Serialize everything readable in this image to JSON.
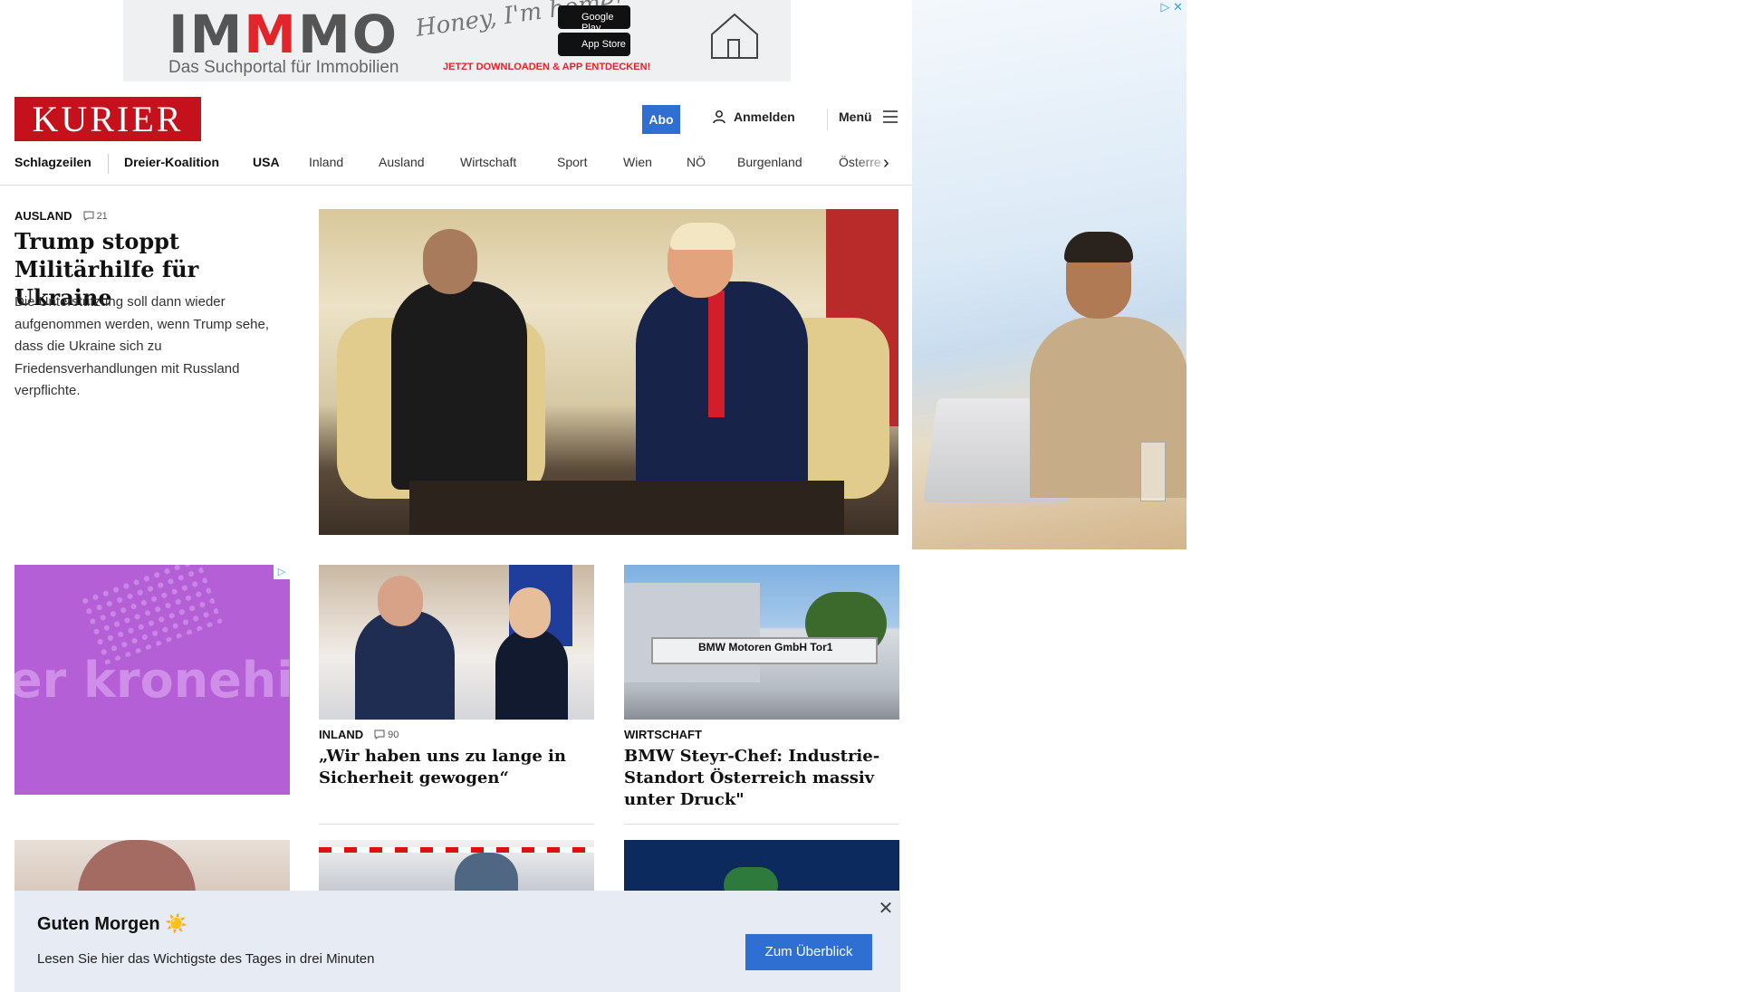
{
  "top_ad": {
    "brand_pre": "IM",
    "brand_m": "M",
    "brand_post": "MO",
    "tagline": "Das Suchportal für Immobilien",
    "script": "Honey, I'm home!",
    "google_play": "Google Play",
    "app_store": "App Store",
    "cta": "JETZT DOWNLOADEN & APP ENTDECKEN!"
  },
  "header": {
    "logo": "KURIER",
    "abo": "Abo",
    "login": "Anmelden",
    "menu": "Menü"
  },
  "nav": {
    "items": [
      "Schlagzeilen",
      "Dreier-Koalition",
      "USA",
      "Inland",
      "Ausland",
      "Wirtschaft",
      "Sport",
      "Wien",
      "NÖ",
      "Burgenland",
      "Österre"
    ]
  },
  "lead": {
    "kicker": "AUSLAND",
    "comments": "21",
    "title": "Trump stoppt Militärhilfe für Ukraine",
    "teaser": "Die Unterstützung soll dann wieder aufgenommen werden, wenn Trump sehe, dass die Ukraine sich zu Friedensverhandlungen mit Russland verpflichte."
  },
  "krone_ad": {
    "text": "er kronehit"
  },
  "card1": {
    "kicker": "INLAND",
    "comments": "90",
    "title": "„Wir haben uns zu lange in Sicherheit gewogen“"
  },
  "card2": {
    "kicker": "WIRTSCHAFT",
    "title": "BMW Steyr-Chef: Industrie-Standort Österreich massiv unter Druck\"",
    "sign": "BMW Motoren GmbH   Tor1"
  },
  "toast": {
    "title": "Guten Morgen ☀️",
    "text": "Lesen Sie hier das Wichtigste des Tages in drei Minuten",
    "button": "Zum Überblick",
    "close": "✕"
  },
  "colors": {
    "brand_red": "#c4111b",
    "accent_blue": "#2f6fd1",
    "toast_bg": "#e7ebf3"
  }
}
